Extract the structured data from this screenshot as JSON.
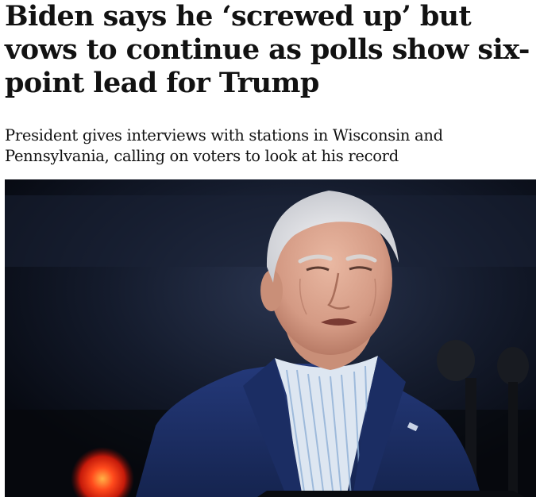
{
  "article": {
    "headline": "Biden says he ‘screwed up’ but vows to continue as polls show six-point lead for Trump",
    "standfirst": "President gives interviews with stations in Wisconsin and Pennsylvania, calling on voters to look at his record"
  },
  "colors": {
    "text": "#121212",
    "background": "#ffffff",
    "photo_background": "#0d1320",
    "jacket": "#1c2f66",
    "red_light": "#ff3a1a"
  }
}
